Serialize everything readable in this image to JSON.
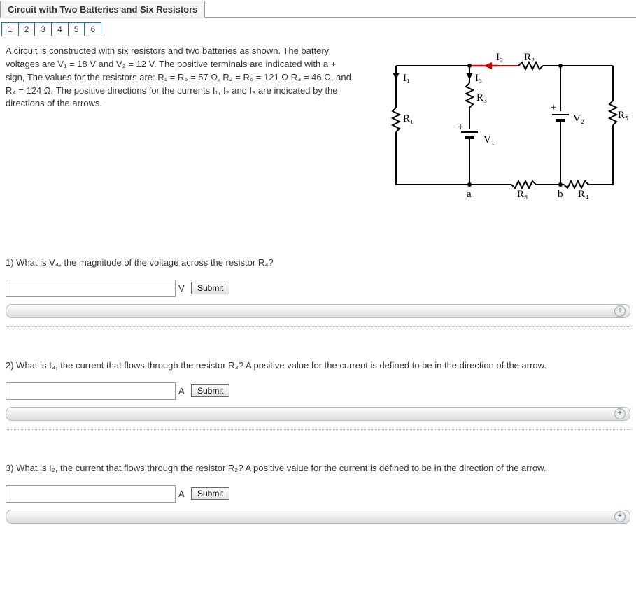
{
  "header": {
    "title": "Circuit with Two Batteries and Six Resistors",
    "tabs": [
      "1",
      "2",
      "3",
      "4",
      "5",
      "6"
    ]
  },
  "intro": {
    "text": "A circuit is constructed with six resistors and two batteries as shown. The battery voltages are V₁ = 18 V and V₂ = 12 V. The positive terminals are indicated with a + sign, The values for the resistors are: R₁ = R₅ = 57 Ω, R₂ = R₆ = 121 Ω R₃ = 46 Ω, and R₄ = 124 Ω. The positive directions for the currents I₁, I₂ and I₃ are indicated by the directions of the arrows."
  },
  "diagram": {
    "labels": {
      "I1": "I₁",
      "I2": "I₂",
      "I3": "I₃",
      "R1": "R₁",
      "R2": "R₂",
      "R3": "R₃",
      "R4": "R₄",
      "R5": "R₅",
      "R6": "R₆",
      "V1": "V₁",
      "V2": "V₂",
      "a": "a",
      "b": "b",
      "plus": "+"
    }
  },
  "questions": {
    "q1": {
      "prompt": "1) What is V₄, the magnitude of the voltage across the resistor R₄?",
      "unit": "V",
      "submit": "Submit"
    },
    "q2": {
      "prompt": "2) What is I₃, the current that flows through the resistor R₃? A positive value for the current is defined to be in the direction of the arrow.",
      "unit": "A",
      "submit": "Submit"
    },
    "q3": {
      "prompt": "3) What is I₂, the current that flows through the resistor R₂? A positive value for the current is defined to be in the direction of the arrow.",
      "unit": "A",
      "submit": "Submit"
    }
  },
  "expand_icon": "+"
}
